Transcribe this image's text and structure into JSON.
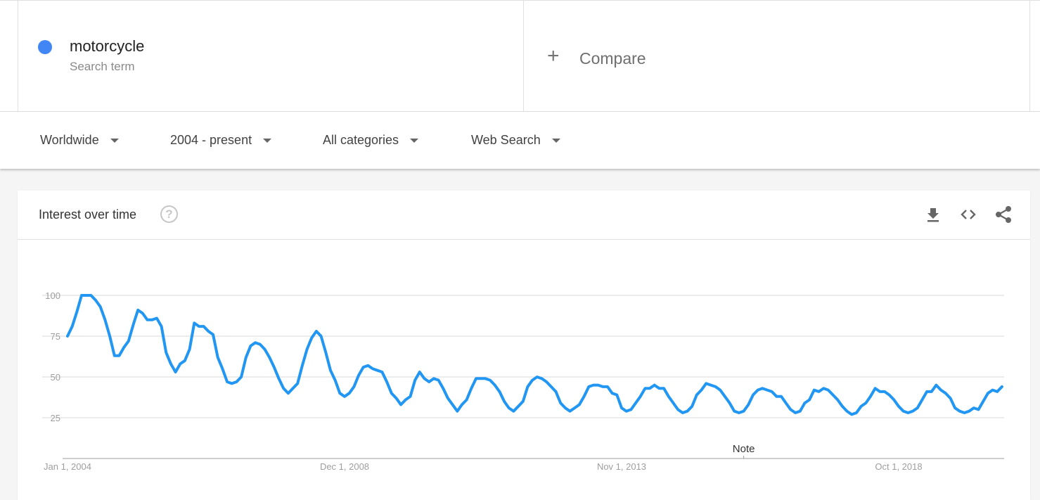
{
  "search_term": {
    "name": "motorcycle",
    "subtitle": "Search term",
    "color": "#4285f4"
  },
  "compare": {
    "plus_icon": "plus-icon",
    "label": "Compare"
  },
  "filters": [
    {
      "label": "Worldwide"
    },
    {
      "label": "2004 - present"
    },
    {
      "label": "All categories"
    },
    {
      "label": "Web Search"
    }
  ],
  "card": {
    "title": "Interest over time",
    "help_icon": "?",
    "actions": [
      "download-icon",
      "embed-icon",
      "share-icon"
    ]
  },
  "chart_data": {
    "type": "line",
    "title": "Interest over time",
    "xlabel": "",
    "ylabel": "",
    "ylim": [
      0,
      100
    ],
    "yticks": [
      25,
      50,
      75,
      100
    ],
    "x_start": "2004-01",
    "x_frequency": "monthly",
    "x_ticks": [
      {
        "label": "Jan 1, 2004",
        "month_index": 0
      },
      {
        "label": "Dec 1, 2008",
        "month_index": 59
      },
      {
        "label": "Nov 1, 2013",
        "month_index": 118
      },
      {
        "label": "Oct 1, 2018",
        "month_index": 177
      }
    ],
    "annotations": [
      {
        "label": "Note",
        "month_index": 144
      }
    ],
    "grid": true,
    "series": [
      {
        "name": "motorcycle",
        "color": "#2196f3",
        "values": [
          75,
          81,
          90,
          100,
          100,
          100,
          97,
          93,
          85,
          75,
          63,
          63,
          68,
          72,
          82,
          91,
          89,
          85,
          85,
          86,
          81,
          65,
          58,
          53,
          58,
          60,
          67,
          83,
          81,
          81,
          78,
          76,
          62,
          55,
          47,
          46,
          47,
          50,
          62,
          69,
          71,
          70,
          67,
          62,
          56,
          49,
          43,
          40,
          43,
          46,
          57,
          67,
          74,
          78,
          75,
          65,
          54,
          48,
          40,
          38,
          40,
          44,
          51,
          56,
          57,
          55,
          54,
          53,
          47,
          40,
          37,
          33,
          36,
          38,
          48,
          53,
          49,
          47,
          49,
          48,
          43,
          37,
          33,
          29,
          33,
          36,
          43,
          49,
          49,
          49,
          48,
          45,
          41,
          35,
          31,
          29,
          32,
          35,
          44,
          48,
          50,
          49,
          47,
          44,
          41,
          34,
          31,
          29,
          31,
          33,
          38,
          44,
          45,
          45,
          44,
          44,
          40,
          39,
          31,
          29,
          30,
          34,
          38,
          43,
          43,
          45,
          43,
          43,
          38,
          34,
          30,
          28,
          29,
          32,
          39,
          42,
          46,
          45,
          44,
          42,
          38,
          34,
          29,
          28,
          29,
          33,
          39,
          42,
          43,
          42,
          41,
          38,
          38,
          34,
          30,
          28,
          29,
          34,
          36,
          42,
          41,
          43,
          42,
          39,
          36,
          32,
          29,
          27,
          28,
          32,
          34,
          38,
          43,
          41,
          41,
          39,
          36,
          32,
          29,
          28,
          29,
          31,
          36,
          41,
          41,
          45,
          42,
          40,
          37,
          31,
          29,
          28,
          29,
          31,
          30,
          35,
          40,
          42,
          41,
          44
        ]
      }
    ]
  }
}
